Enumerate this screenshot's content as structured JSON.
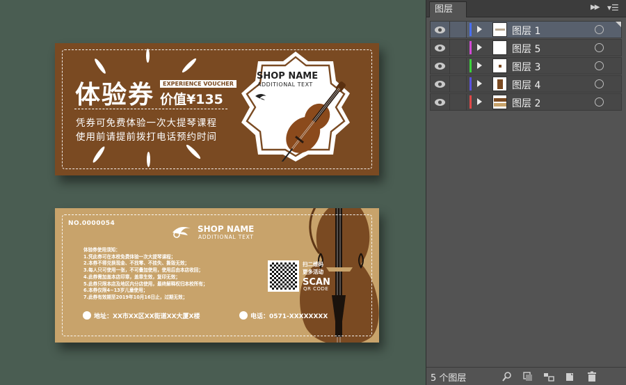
{
  "front": {
    "title": "体验券",
    "tag": "EXPERIENCE VOUCHER",
    "value": "价值¥135",
    "line1": "凭券可免费体验一次大提琴课程",
    "line2": "使用前请提前拨打电话预约时间",
    "shop_name": "SHOP NAME",
    "additional": "ADDITIONAL TEXT",
    "background": "#7a4a22"
  },
  "back": {
    "number": "NO.0000054",
    "shop_name": "SHOP NAME",
    "additional": "ADDITIONAL TEXT",
    "rules": [
      "体验券使用须知：",
      "1.凭此券可在本校免费体验一次大提琴课程；",
      "2.本券不得兑换现金、不找零、不挂失、撕毁无效；",
      "3.每人只可使用一张，不可叠加使用，使用后由本店收回；",
      "4.此券需加盖本店印章，盖章生效，复印无效；",
      "5.此券只限本店及地区内分店使用，最终解释权归本校所有；",
      "6.本券仅限4~13岁儿童使用；",
      "7.此券有效期至2019年10月16日止，过期无效；"
    ],
    "scan_l1": "扫二维码",
    "scan_l2": "更多活动",
    "scan": "SCAN",
    "qr_code": "QR CODE",
    "address": "地址：XX市XX区XX街道XX大厦X楼",
    "phone": "电话：0571-XXXXXXXX",
    "background": "#c8a36b"
  },
  "panel": {
    "tab": "图层",
    "count": "5 个图层",
    "layers": [
      {
        "name": "图层 1",
        "color": "#4a6ff0",
        "selected": true
      },
      {
        "name": "图层 5",
        "color": "#d24ad6",
        "selected": false
      },
      {
        "name": "图层 3",
        "color": "#3ad43a",
        "selected": false
      },
      {
        "name": "图层 4",
        "color": "#5a52e0",
        "selected": false
      },
      {
        "name": "图层 2",
        "color": "#e04848",
        "selected": false
      }
    ]
  }
}
